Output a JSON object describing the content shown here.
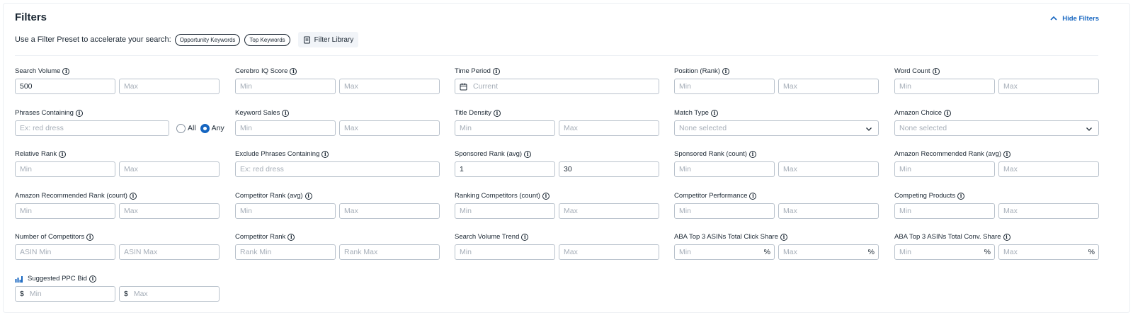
{
  "header": {
    "title": "Filters",
    "hide_label": "Hide Filters",
    "preset_label": "Use a Filter Preset to accelerate your search:",
    "presets": [
      "Opportunity Keywords",
      "Top Keywords"
    ],
    "library_label": "Filter Library"
  },
  "colors": {
    "accent": "#1565c0",
    "border": "#b9c2cc",
    "text": "#1b2733",
    "placeholder": "#a6aeb8"
  },
  "filters": {
    "search_volume": {
      "label": "Search Volume",
      "min": "500",
      "max": "Max"
    },
    "cerebro_iq": {
      "label": "Cerebro IQ Score",
      "min": "Min",
      "max": "Max"
    },
    "time_period": {
      "label": "Time Period",
      "value": "Current"
    },
    "position_rank": {
      "label": "Position (Rank)",
      "min": "Min",
      "max": "Max"
    },
    "word_count": {
      "label": "Word Count",
      "min": "Min",
      "max": "Max"
    },
    "phrases_containing": {
      "label": "Phrases Containing",
      "placeholder": "Ex: red dress",
      "opt_all": "All",
      "opt_any": "Any",
      "selected": "Any"
    },
    "keyword_sales": {
      "label": "Keyword Sales",
      "min": "Min",
      "max": "Max"
    },
    "title_density": {
      "label": "Title Density",
      "min": "Min",
      "max": "Max"
    },
    "match_type": {
      "label": "Match Type",
      "value": "None selected"
    },
    "amazon_choice": {
      "label": "Amazon Choice",
      "value": "None selected"
    },
    "relative_rank": {
      "label": "Relative Rank",
      "min": "Min",
      "max": "Max"
    },
    "exclude_phrases": {
      "label": "Exclude Phrases Containing",
      "placeholder": "Ex: red dress"
    },
    "sponsored_rank_avg": {
      "label": "Sponsored Rank (avg)",
      "min": "1",
      "max": "30"
    },
    "sponsored_rank_count": {
      "label": "Sponsored Rank (count)",
      "min": "Min",
      "max": "Max"
    },
    "amazon_rec_rank_avg": {
      "label": "Amazon Recommended Rank (avg)",
      "min": "Min",
      "max": "Max"
    },
    "amazon_rec_rank_count": {
      "label": "Amazon Recommended Rank (count)",
      "min": "Min",
      "max": "Max"
    },
    "competitor_rank_avg": {
      "label": "Competitor Rank (avg)",
      "min": "Min",
      "max": "Max"
    },
    "ranking_competitors_count": {
      "label": "Ranking Competitors (count)",
      "min": "Min",
      "max": "Max"
    },
    "competitor_performance": {
      "label": "Competitor Performance",
      "min": "Min",
      "max": "Max"
    },
    "competing_products": {
      "label": "Competing Products",
      "min": "Min",
      "max": "Max"
    },
    "number_of_competitors": {
      "label": "Number of Competitors",
      "min": "ASIN Min",
      "max": "ASIN Max"
    },
    "competitor_rank": {
      "label": "Competitor Rank",
      "min": "Rank Min",
      "max": "Rank Max"
    },
    "search_volume_trend": {
      "label": "Search Volume Trend",
      "min": "Min",
      "max": "Max"
    },
    "aba_click_share": {
      "label": "ABA Top 3 ASINs Total Click Share",
      "min": "Min",
      "max": "Max",
      "unit": "%"
    },
    "aba_conv_share": {
      "label": "ABA Top 3 ASINs Total Conv. Share",
      "min": "Min",
      "max": "Max",
      "unit": "%"
    },
    "suggested_ppc_bid": {
      "label": "Suggested PPC Bid",
      "min": "Min",
      "max": "Max",
      "currency": "$"
    }
  }
}
